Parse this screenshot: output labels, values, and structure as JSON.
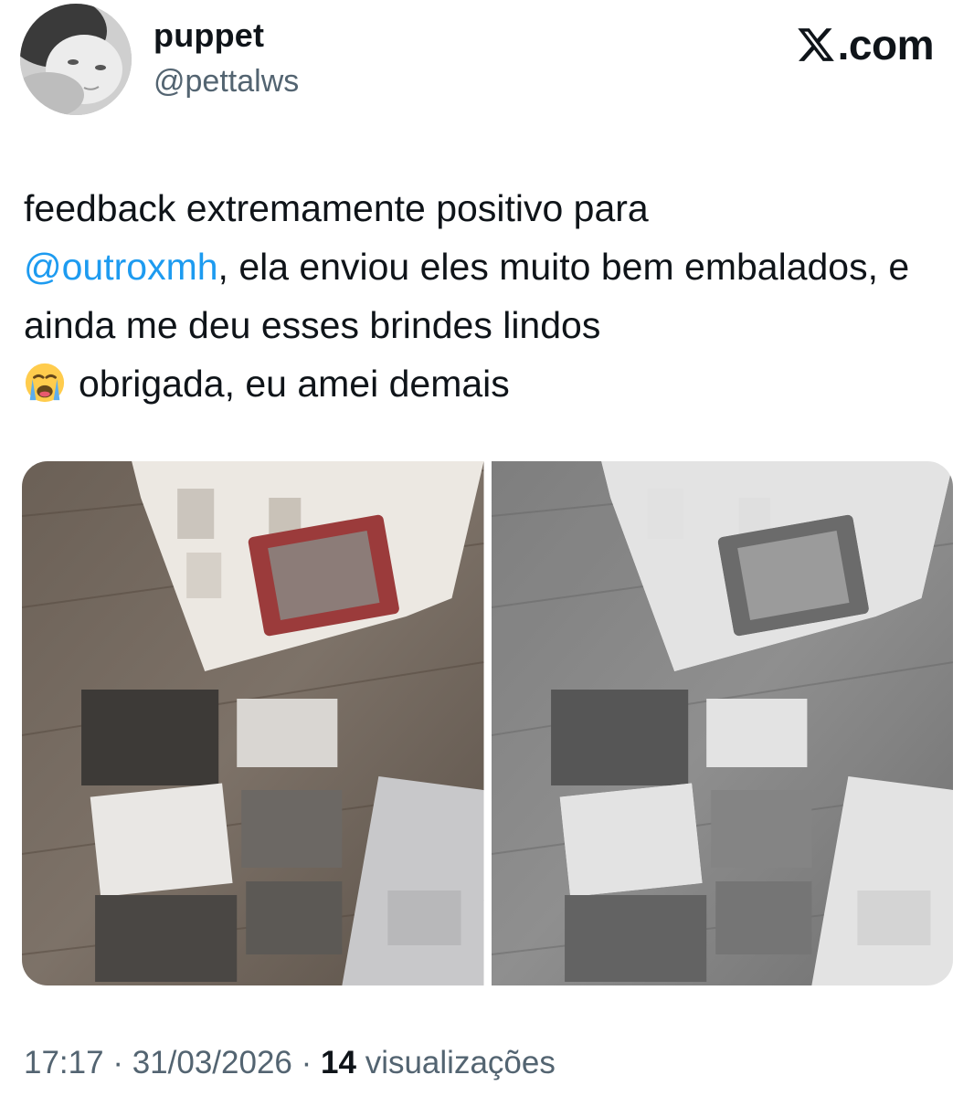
{
  "author": {
    "display_name": "puppet",
    "handle": "@pettalws"
  },
  "brand": {
    "label": ".com",
    "logo_icon": "x-logo-icon"
  },
  "tweet": {
    "text_line1": "feedback extremamente positivo para",
    "mention": "@outroxmh",
    "text_after_mention": ", ela enviou eles muito bem embalados, e ainda me deu esses brindes lindos",
    "emoji": "loudly-crying-face",
    "text_end": "obrigada, eu amei demais"
  },
  "media": {
    "count": 2,
    "photos": [
      {
        "name": "photo-color",
        "style": "color"
      },
      {
        "name": "photo-grayscale",
        "style": "grayscale"
      }
    ]
  },
  "footer": {
    "time": "17:17",
    "separator": "·",
    "date": "31/03/2026",
    "views_count": "14",
    "views_label": "visualizações"
  },
  "colors": {
    "text": "#0f1419",
    "secondary": "#536471",
    "link": "#1d9bf0",
    "background": "#ffffff"
  }
}
